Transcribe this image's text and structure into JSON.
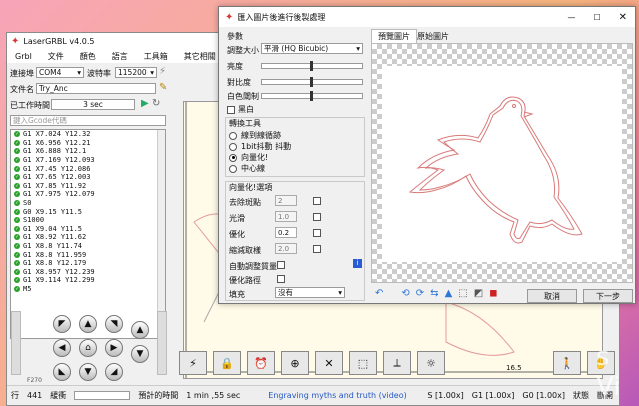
{
  "main": {
    "title": "LaserGRBL v4.0.5",
    "menu": [
      "Grbl",
      "文件",
      "顏色",
      "語言",
      "工具箱",
      "其它相關"
    ],
    "port_label": "連接埠",
    "port_value": "COM4",
    "baud_label": "波特率",
    "baud_value": "115200",
    "file_label": "文件名",
    "file_value": "Try_Anc",
    "time_label": "已工作時間",
    "time_value": "3 sec",
    "gcode_placeholder": "鍵入Gcode代碼",
    "gcode_lines": [
      "G1 X7.024 Y12.32",
      "G1 X6.956 Y12.21",
      "G1 X6.888 Y12.1",
      "G1 X7.169 Y12.093",
      "G1 X7.45 Y12.086",
      "G1 X7.65 Y12.003",
      "G1 X7.85 Y11.92",
      "G1 X7.975 Y12.079",
      "S0",
      "G0 X9.15 Y11.5",
      "S1000",
      "G1 X9.04 Y11.5",
      "G1 X8.92 Y11.62",
      "G1 X8.8 Y11.74",
      "G1 X8.8 Y11.959",
      "G1 X8.8 Y12.179",
      "G1 X8.957 Y12.239",
      "G1 X9.114 Y12.299",
      "M5"
    ],
    "ruler_16": "16",
    "ruler_165": "16.5",
    "f_label": "F270",
    "status": {
      "lines_label": "行",
      "lines_value": "441",
      "buffer_label": "緩衝",
      "est_label": "預計的時間",
      "est_value": "1 min ,55 sec",
      "marquee": "Engraving myths and truth (video)",
      "s_val": "S [1.00x]",
      "g1_val": "G1 [1.00x]",
      "g0_val": "G0 [1.00x]",
      "state_label": "狀態",
      "state_value": "斷開"
    }
  },
  "dialog": {
    "title": "匯入圖片後進行後製處理",
    "params_label": "參數",
    "resize_label": "調整大小",
    "resize_value": "平滑 (HQ Bicubic)",
    "brightness_label": "亮度",
    "contrast_label": "對比度",
    "white_clip_label": "白色閾制",
    "grayscale_label": "黑白",
    "convert_tools_label": "轉換工具",
    "opt_line": "線到線循跡",
    "opt_1bit": "1bit抖動 抖動",
    "opt_vector": "向量化!",
    "opt_center": "中心線",
    "vector_label": "向量化!選項",
    "despeckle_label": "去除斑點",
    "despeckle_value": "2",
    "smooth_label": "光滑",
    "smooth_value": "1.0",
    "optimize_label": "優化",
    "optimize_value": "0.2",
    "downsample_label": "縮減取樣",
    "downsample_value": "2.0",
    "auto_adjust_label": "自動調整質量",
    "opt_path_label": "優化路徑",
    "fill_label": "填充",
    "fill_value": "沒有",
    "tab_preview": "預覽圖片",
    "tab_original": "原始圖片",
    "cancel": "取消",
    "next": "下一步"
  },
  "desktop": {
    "text": "s Vi"
  }
}
